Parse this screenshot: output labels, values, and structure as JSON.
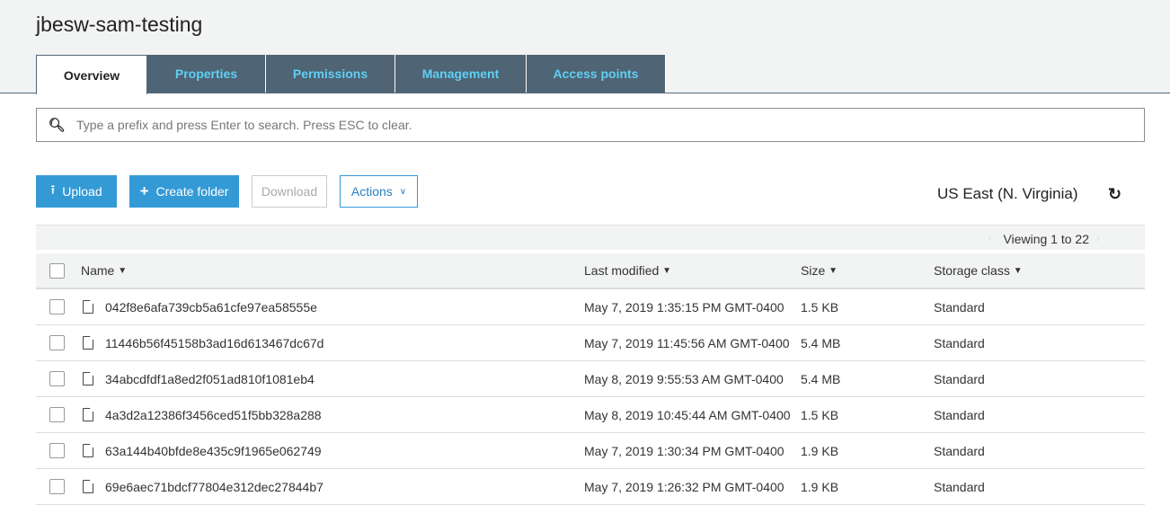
{
  "bucket_title": "jbesw-sam-testing",
  "tabs": [
    "Overview",
    "Properties",
    "Permissions",
    "Management",
    "Access points"
  ],
  "search": {
    "placeholder": "Type a prefix and press Enter to search. Press ESC to clear."
  },
  "toolbar": {
    "upload": "Upload",
    "create_folder": "Create folder",
    "download": "Download",
    "actions": "Actions"
  },
  "region": "US East (N. Virginia)",
  "viewing": "Viewing 1 to 22",
  "columns": {
    "name": "Name",
    "modified": "Last modified",
    "size": "Size",
    "storage": "Storage class"
  },
  "rows": [
    {
      "name": "042f8e6afa739cb5a61cfe97ea58555e",
      "modified": "May 7, 2019 1:35:15 PM GMT-0400",
      "size": "1.5 KB",
      "storage": "Standard"
    },
    {
      "name": "11446b56f45158b3ad16d613467dc67d",
      "modified": "May 7, 2019 11:45:56 AM GMT-0400",
      "size": "5.4 MB",
      "storage": "Standard"
    },
    {
      "name": "34abcdfdf1a8ed2f051ad810f1081eb4",
      "modified": "May 8, 2019 9:55:53 AM GMT-0400",
      "size": "5.4 MB",
      "storage": "Standard"
    },
    {
      "name": "4a3d2a12386f3456ced51f5bb328a288",
      "modified": "May 8, 2019 10:45:44 AM GMT-0400",
      "size": "1.5 KB",
      "storage": "Standard"
    },
    {
      "name": "63a144b40bfde8e435c9f1965e062749",
      "modified": "May 7, 2019 1:30:34 PM GMT-0400",
      "size": "1.9 KB",
      "storage": "Standard"
    },
    {
      "name": "69e6aec71bdcf77804e312dec27844b7",
      "modified": "May 7, 2019 1:26:32 PM GMT-0400",
      "size": "1.9 KB",
      "storage": "Standard"
    }
  ]
}
